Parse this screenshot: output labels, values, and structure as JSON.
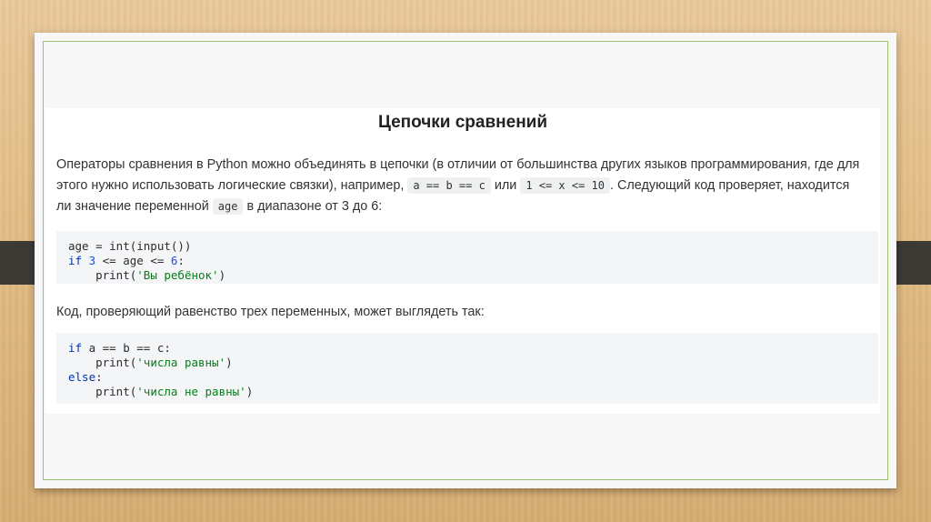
{
  "title": "Цепочки сравнений",
  "para1": {
    "line1": "Операторы сравнения в Python можно объединять в цепочки (в отличии от большинства других языков программирования, где для",
    "line2_a": "этого нужно использовать логические связки), например, ",
    "code_a": "a == b == c",
    "line2_b": " или ",
    "code_b": "1 <= x <= 10",
    "line2_c": ". Следующий код проверяет, находится",
    "line3_a": "ли значение переменной ",
    "code_c": "age",
    "line3_b": " в диапазоне от 3 до 6:"
  },
  "code1": {
    "l1": "age = int(input())",
    "l2_kw": "if",
    "l2_a": " ",
    "l2_n1": "3",
    "l2_b": " <= age <= ",
    "l2_n2": "6",
    "l2_c": ":",
    "l3_a": "    print(",
    "l3_s": "'Вы ребёнок'",
    "l3_b": ")"
  },
  "para2": "Код, проверяющий равенство трех переменных, может выглядеть так:",
  "code2": {
    "l1_kw": "if",
    "l1_rest": " a == b == c:",
    "l2_a": "    print(",
    "l2_s": "'числа равны'",
    "l2_b": ")",
    "l3_kw": "else",
    "l3_rest": ":",
    "l4_a": "    print(",
    "l4_s": "'числа не равны'",
    "l4_b": ")"
  }
}
